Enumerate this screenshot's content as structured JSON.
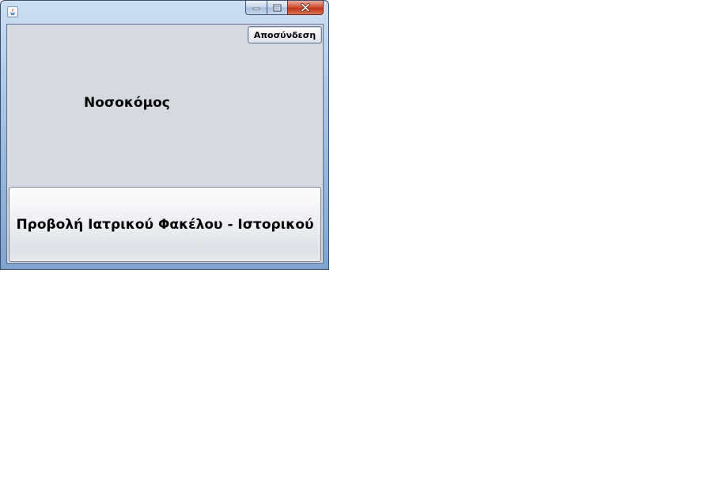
{
  "window": {
    "title": "",
    "icon": "java-icon",
    "controls": {
      "minimize_icon": "minimize-icon",
      "maximize_icon": "maximize-icon",
      "close_icon": "close-icon"
    }
  },
  "main": {
    "logout_label": "Αποσύνδεση",
    "role_label": "Νοσοκόμος",
    "records_button_label": "Προβολή Ιατρικού Φακέλου - Ιστορικού"
  },
  "colors": {
    "client_background": "#d7d9e0",
    "close_button": "#c33517"
  }
}
